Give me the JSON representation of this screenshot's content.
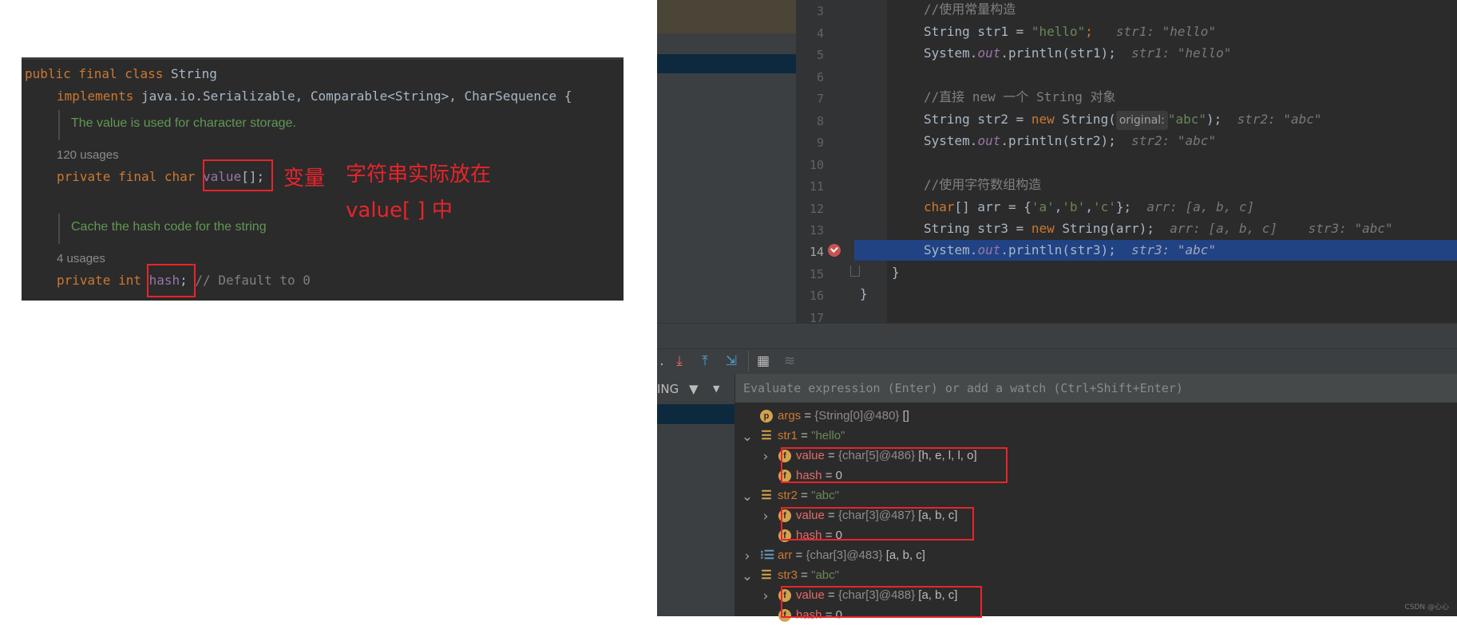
{
  "source_panel": {
    "lines": {
      "class_decl_kw": "public final class",
      "class_name": "String",
      "implements_kw": "implements",
      "implements_rest": "java.io.Serializable, Comparable<String>, CharSequence {",
      "doc1": "The value is used for character storage.",
      "usages1": "120 usages",
      "value_decl_kw": "private final char",
      "value_field": "value",
      "value_suffix": "[];",
      "doc2": "Cache the hash code for the string",
      "usages2": "4 usages",
      "hash_decl_kw": "private int",
      "hash_field": "hash",
      "hash_suffix": ";",
      "hash_comment": "// Default to 0"
    },
    "annotations": {
      "variable": "变量",
      "stored_line1": "字符串实际放在",
      "stored_line2": "value[ ] 中"
    }
  },
  "ide": {
    "line_numbers": [
      "3",
      "4",
      "5",
      "6",
      "7",
      "8",
      "9",
      "10",
      "11",
      "12",
      "13",
      "14",
      "15",
      "16",
      "17"
    ],
    "current_line": "14",
    "code": {
      "l3": "//使用常量构造",
      "l4_code": "String str1 = ",
      "l4_str": "\"hello\"",
      "l4_end": ";",
      "l4_hint": "str1: \"hello\"",
      "l5_a": "System.",
      "l5_out": "out",
      "l5_b": ".println(str1);",
      "l5_hint": "str1: \"hello\"",
      "l7": "//直接 new 一个 String 对象",
      "l8_a": "String str2 = ",
      "l8_new": "new",
      "l8_b": " String(",
      "l8_param": "original:",
      "l8_str": "\"abc\"",
      "l8_end": ");",
      "l8_hint": "str2: \"abc\"",
      "l9_a": "System.",
      "l9_out": "out",
      "l9_b": ".println(str2);",
      "l9_hint": "str2: \"abc\"",
      "l11": "//使用字符数组构造",
      "l12_kw": "char",
      "l12_a": "[] arr = {",
      "l12_c1": "'a'",
      "l12_c2": "'b'",
      "l12_c3": "'c'",
      "l12_end": "};",
      "l12_hint": "arr: [a, b, c]",
      "l13_a": "String str3 = ",
      "l13_new": "new",
      "l13_b": " String(arr);",
      "l13_hint1": "arr: [a, b, c]",
      "l13_hint2": "str3: \"abc\"",
      "l14_a": "System.",
      "l14_out": "out",
      "l14_b": ".println(str3);",
      "l14_hint": "str3: \"abc\"",
      "l15": "}",
      "l16": "}"
    },
    "frames_label": "ING",
    "eval_placeholder": "Evaluate expression (Enter) or add a watch (Ctrl+Shift+Enter)",
    "variables": [
      {
        "name": "args",
        "type": "{String[0]@480}",
        "value": "[]"
      },
      {
        "name": "str1",
        "value": "\"hello\""
      },
      {
        "name": "value",
        "type": "{char[5]@486}",
        "value": "[h, e, l, l, o]"
      },
      {
        "name": "hash",
        "value": "0"
      },
      {
        "name": "str2",
        "value": "\"abc\""
      },
      {
        "name": "value",
        "type": "{char[3]@487}",
        "value": "[a, b, c]"
      },
      {
        "name": "hash",
        "value": "0"
      },
      {
        "name": "arr",
        "type": "{char[3]@483}",
        "value": "[a, b, c]"
      },
      {
        "name": "str3",
        "value": "\"abc\""
      },
      {
        "name": "value",
        "type": "{char[3]@488}",
        "value": "[a, b, c]"
      },
      {
        "name": "hash",
        "value": "0"
      }
    ],
    "watermark": "CSDN @心心"
  },
  "colors": {
    "annotation_red": "#e8242b",
    "current_line_blue": "#214283",
    "breakpoint_red": "#c75450"
  }
}
